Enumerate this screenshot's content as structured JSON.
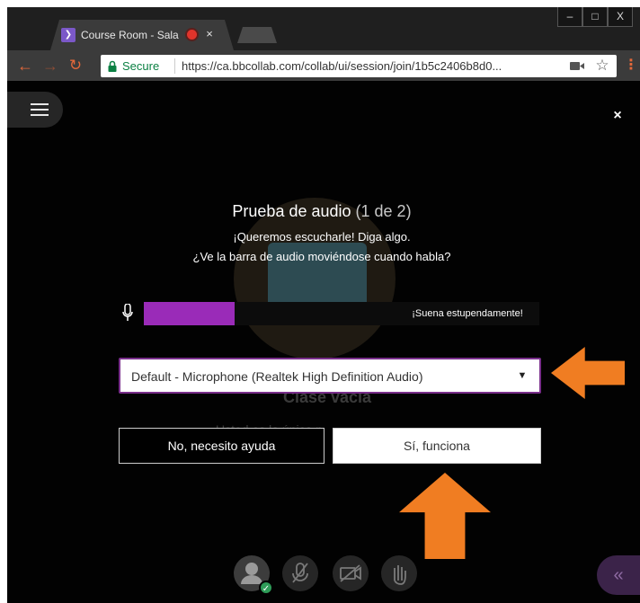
{
  "browser": {
    "tab_title": "Course Room - Sala d",
    "tab_close": "×",
    "window_controls": {
      "minimize": "–",
      "maximize": "□",
      "close": "X"
    },
    "back": "←",
    "forward": "→",
    "reload": "↻",
    "secure_label": "Secure",
    "url": "https://ca.bbcollab.com/collab/ui/session/join/1b5c2406b8d0...",
    "bookmark_star": "☆",
    "menu_dots": "⋮"
  },
  "page": {
    "close": "×",
    "empty_room_title": "Clase vacía",
    "empty_room_subtitle": "Usted es la única p"
  },
  "audio_test": {
    "title": "Prueba de audio",
    "step": "(1 de 2)",
    "instruction_1": "¡Queremos escucharle! Diga algo.",
    "instruction_2": "¿Ve la barra de audio moviéndose cuando habla?",
    "level_status": "¡Suena estupendamente!",
    "level_fraction": 0.36,
    "device_selected": "Default - Microphone (Realtek High Definition Audio)",
    "caret": "▼",
    "help_button": "No, necesito ayuda",
    "confirm_button": "Sí, funciona"
  },
  "controls": {
    "avatar_status": "✓",
    "panel_toggle": "«"
  },
  "colors": {
    "accent_purple": "#9a2bb8",
    "annotation_orange": "#f07d22",
    "secure_green": "#0b8043"
  }
}
